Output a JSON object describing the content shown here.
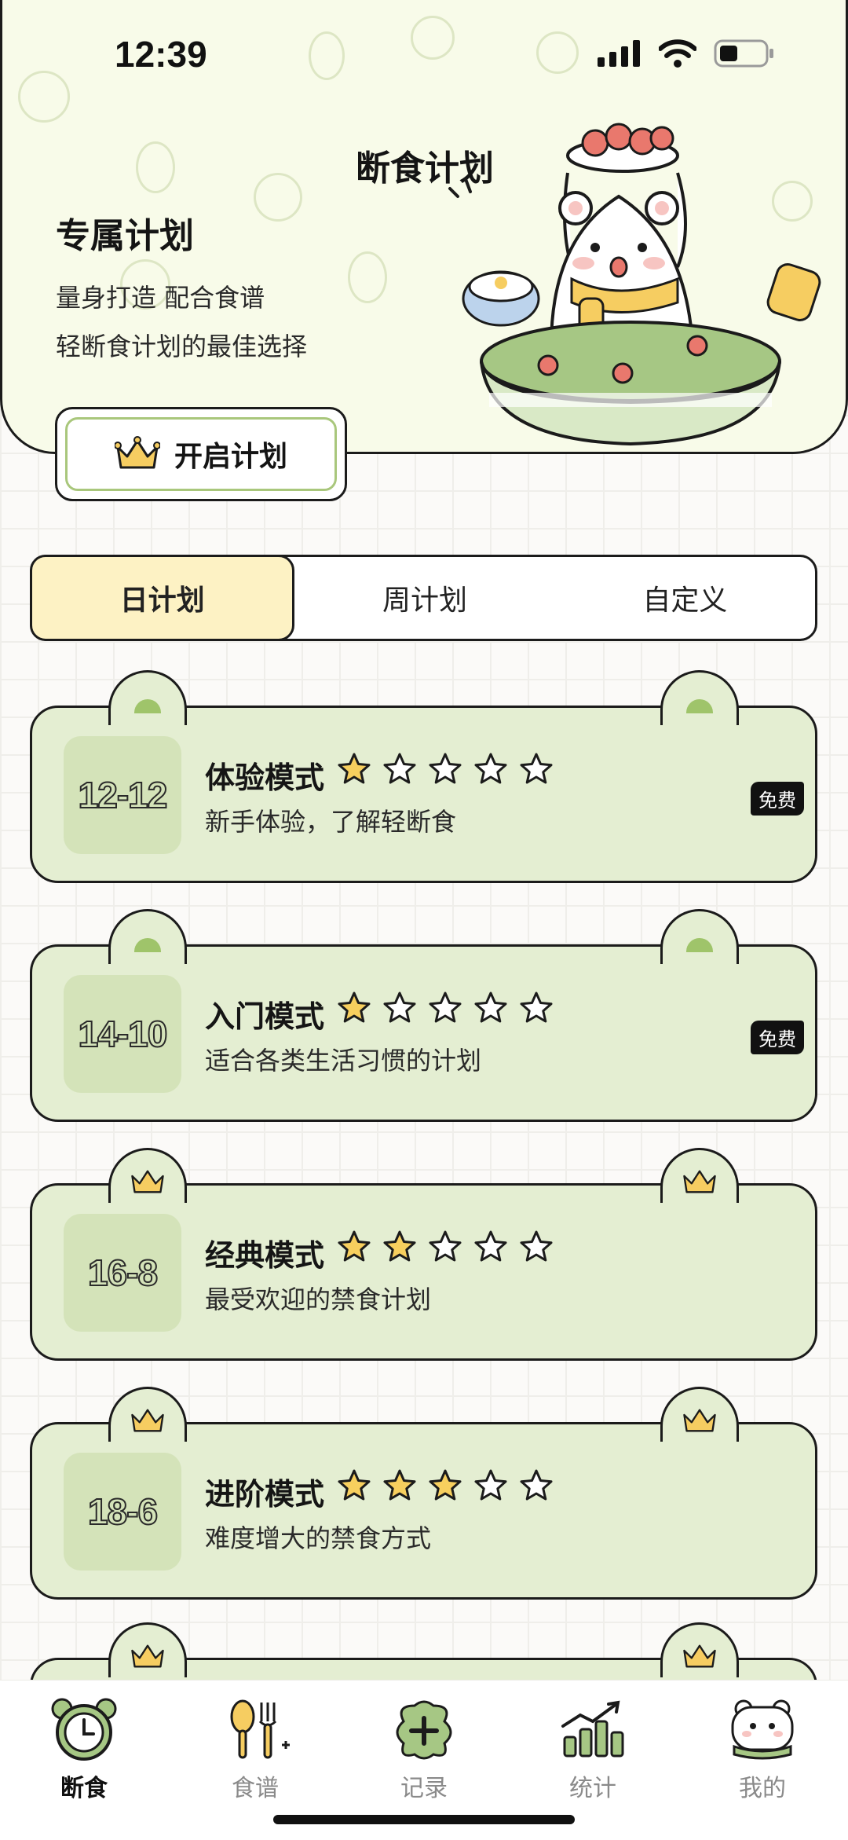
{
  "status_bar": {
    "time": "12:39"
  },
  "hero": {
    "title": "断食计划",
    "subtitle": "专属计划",
    "desc_line1": "量身打造 配合食谱",
    "desc_line2": "轻断食计划的最佳选择",
    "start_button": "开启计划"
  },
  "tabs": [
    {
      "label": "日计划",
      "active": true
    },
    {
      "label": "周计划",
      "active": false
    },
    {
      "label": "自定义",
      "active": false
    }
  ],
  "plans": [
    {
      "code": "12-12",
      "name": "体验模式",
      "desc": "新手体验，了解轻断食",
      "stars": 1,
      "badge": "免费",
      "premium": false
    },
    {
      "code": "14-10",
      "name": "入门模式",
      "desc": "适合各类生活习惯的计划",
      "stars": 1,
      "badge": "免费",
      "premium": false
    },
    {
      "code": "16-8",
      "name": "经典模式",
      "desc": "最受欢迎的禁食计划",
      "stars": 2,
      "badge": "",
      "premium": true
    },
    {
      "code": "18-6",
      "name": "进阶模式",
      "desc": "难度增大的禁食方式",
      "stars": 3,
      "badge": "",
      "premium": true
    }
  ],
  "nav": [
    {
      "label": "断食",
      "icon": "clock-icon",
      "active": true
    },
    {
      "label": "食谱",
      "icon": "cutlery-icon",
      "active": false
    },
    {
      "label": "记录",
      "icon": "add-record-icon",
      "active": false
    },
    {
      "label": "统计",
      "icon": "chart-icon",
      "active": false
    },
    {
      "label": "我的",
      "icon": "bear-avatar-icon",
      "active": false
    }
  ],
  "colors": {
    "accent_green": "#e4eed2",
    "tab_active": "#fdf2c4",
    "star_fill": "#f7cf5e"
  }
}
